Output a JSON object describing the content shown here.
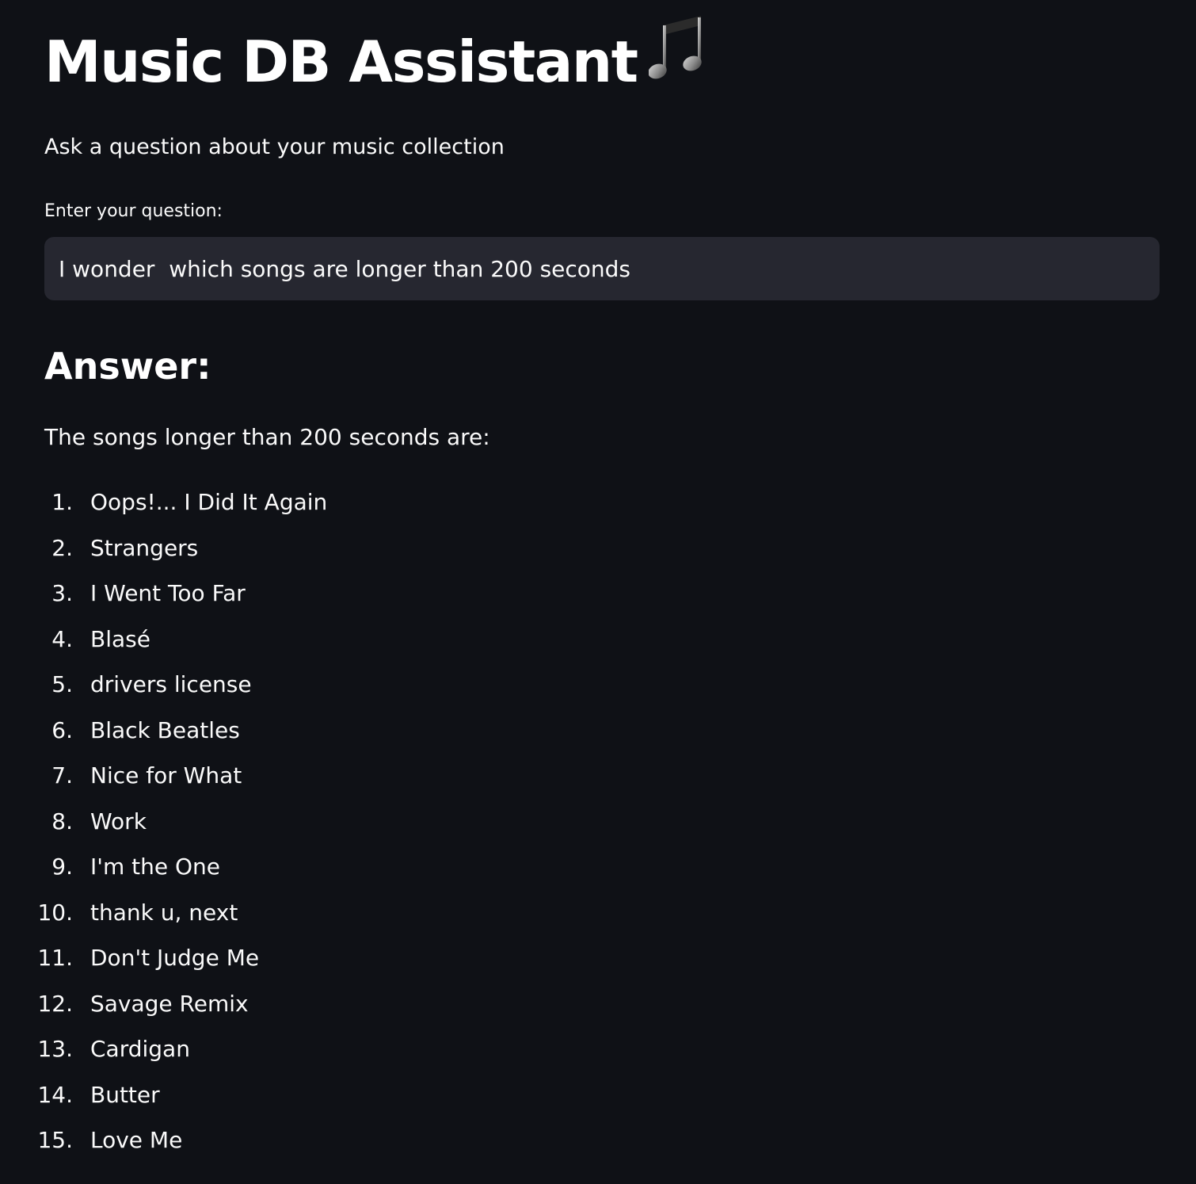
{
  "header": {
    "title": "Music DB Assistant",
    "title_icon": "musical-notes-icon",
    "subtitle": "Ask a question about your music collection"
  },
  "question": {
    "label": "Enter your question:",
    "value": "I wonder  which songs are longer than 200 seconds"
  },
  "answer": {
    "heading": "Answer:",
    "intro": "The songs longer than 200 seconds are:",
    "songs": [
      {
        "num": "1.",
        "title": "Oops!... I Did It Again"
      },
      {
        "num": "2.",
        "title": "Strangers"
      },
      {
        "num": "3.",
        "title": "I Went Too Far"
      },
      {
        "num": "4.",
        "title": "Blasé"
      },
      {
        "num": "5.",
        "title": "drivers license"
      },
      {
        "num": "6.",
        "title": "Black Beatles"
      },
      {
        "num": "7.",
        "title": "Nice for What"
      },
      {
        "num": "8.",
        "title": "Work"
      },
      {
        "num": "9.",
        "title": "I'm the One"
      },
      {
        "num": "10.",
        "title": "thank u, next"
      },
      {
        "num": "11.",
        "title": "Don't Judge Me"
      },
      {
        "num": "12.",
        "title": "Savage Remix"
      },
      {
        "num": "13.",
        "title": "Cardigan"
      },
      {
        "num": "14.",
        "title": "Butter"
      },
      {
        "num": "15.",
        "title": "Love Me"
      }
    ]
  },
  "colors": {
    "background": "#0f1116",
    "input_background": "#262730",
    "text": "#fafafa"
  }
}
